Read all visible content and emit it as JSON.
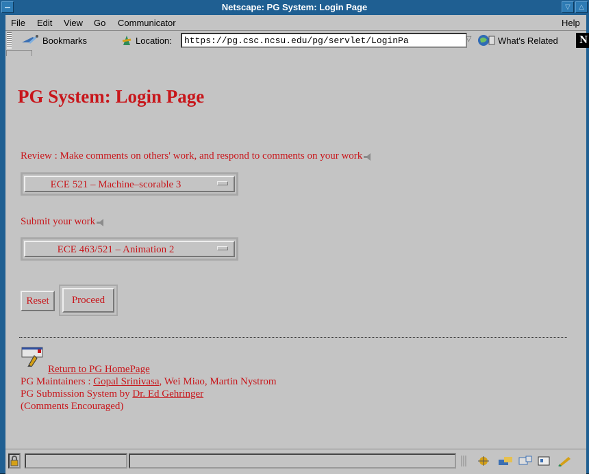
{
  "window": {
    "title": "Netscape: PG System: Login Page"
  },
  "menubar": {
    "items": [
      "File",
      "Edit",
      "View",
      "Go",
      "Communicator"
    ],
    "help": "Help"
  },
  "location_bar": {
    "bookmarks_label": "Bookmarks",
    "location_label": "Location:",
    "url": "https://pg.csc.ncsu.edu/pg/servlet/LoginPa",
    "whats_related_label": "What's Related",
    "logo_letter": "N"
  },
  "page": {
    "heading": "PG System: Login Page",
    "review_text": "Review : Make comments on others' work, and respond to comments on your work",
    "review_select": "ECE 521 – Machine–scorable 3",
    "submit_text": "Submit your work",
    "submit_select": "ECE 463/521 – Animation 2",
    "reset_label": "Reset",
    "proceed_label": "Proceed"
  },
  "footer": {
    "home_link": "Return to PG HomePage",
    "maintainers_prefix": "PG Maintainers : ",
    "maintainer_link": "Gopal Srinivasa",
    "maintainers_rest": ", Wei Miao, Martin Nystrom",
    "system_prefix": "PG Submission System by ",
    "author_link": "Dr. Ed Gehringer",
    "comments": "(Comments Encouraged)"
  },
  "colors": {
    "text": "#c8161b",
    "background": "#c4c4c4",
    "titlebar": "#1f5f92"
  }
}
